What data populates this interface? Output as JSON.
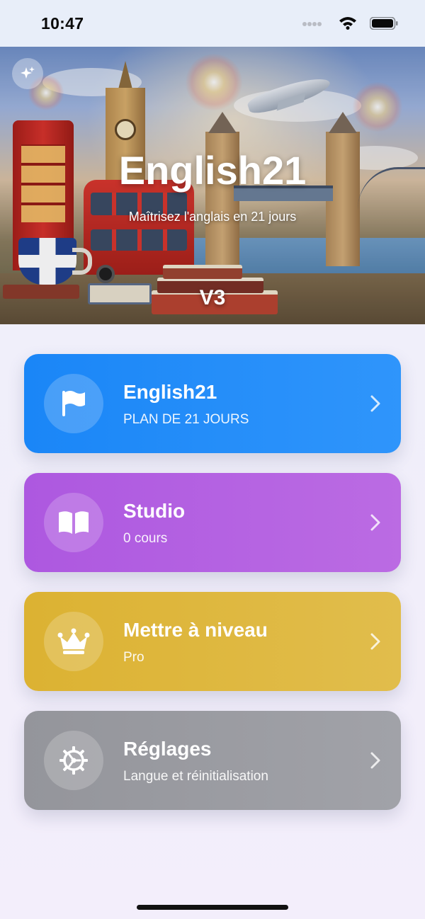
{
  "status_bar": {
    "time": "10:47"
  },
  "hero": {
    "title": "English21",
    "subtitle": "Maîtrisez l'anglais en 21 jours",
    "version": "V3",
    "sparkle_icon": "sparkle-icon"
  },
  "menu": {
    "items": [
      {
        "id": "english21",
        "title": "English21",
        "subtitle": "PLAN DE 21 JOURS",
        "icon": "flag-icon",
        "color": "#1a86f7"
      },
      {
        "id": "studio",
        "title": "Studio",
        "subtitle": "0 cours",
        "icon": "book-icon",
        "color": "#ad58e0"
      },
      {
        "id": "upgrade",
        "title": "Mettre à niveau",
        "subtitle": "Pro",
        "icon": "crown-icon",
        "color": "#dcb232"
      },
      {
        "id": "settings",
        "title": "Réglages",
        "subtitle": "Langue et réinitialisation",
        "icon": "gear-icon",
        "color": "#94959b"
      }
    ]
  }
}
